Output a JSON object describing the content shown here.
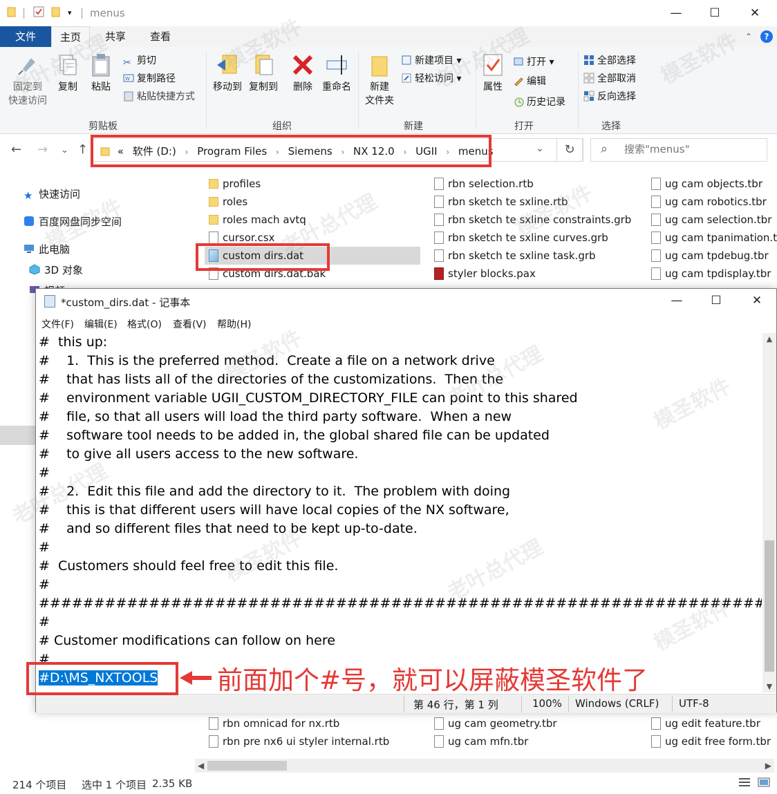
{
  "explorer": {
    "title": "menus",
    "ribbon_tabs": {
      "file": "文件",
      "home": "主页",
      "share": "共享",
      "view": "查看"
    },
    "groups": {
      "clipboard": {
        "label": "剪贴板",
        "pin": "固定到\n快速访问",
        "copy": "复制",
        "paste": "粘贴",
        "cut": "剪切",
        "copy_path": "复制路径",
        "paste_shortcut": "粘贴快捷方式"
      },
      "organize": {
        "label": "组织",
        "move_to": "移动到",
        "copy_to": "复制到",
        "delete": "删除",
        "rename": "重命名"
      },
      "new": {
        "label": "新建",
        "new_folder": "新建\n文件夹",
        "new_item": "新建项目",
        "easy_access": "轻松访问"
      },
      "open": {
        "label": "打开",
        "properties": "属性",
        "open": "打开",
        "edit": "编辑",
        "history": "历史记录"
      },
      "select": {
        "label": "选择",
        "select_all": "全部选择",
        "select_none": "全部取消",
        "invert": "反向选择"
      }
    },
    "address": {
      "prefix": "«",
      "crumbs": [
        "软件 (D:)",
        "Program Files",
        "Siemens",
        "NX 12.0",
        "UGII",
        "menus"
      ]
    },
    "search": {
      "placeholder": "搜索\"menus\""
    },
    "nav": {
      "quick_access": "快速访问",
      "baidu": "百度网盘同步空间",
      "this_pc": "此电脑",
      "objects_3d": "3D 对象",
      "video_partial": "视频"
    },
    "files_col1": [
      "profiles",
      "roles",
      "roles mach avtq",
      "cursor.csx",
      "custom dirs.dat",
      "custom dirs.dat.bak"
    ],
    "files_col2": [
      "rbn selection.rtb",
      "rbn sketch te sxline.rtb",
      "rbn sketch te sxline constraints.grb",
      "rbn sketch te sxline curves.grb",
      "rbn sketch te sxline task.grb",
      "styler blocks.pax"
    ],
    "files_col3": [
      "ug cam objects.tbr",
      "ug cam robotics.tbr",
      "ug cam selection.tbr",
      "ug cam tpanimation.t",
      "ug cam tpdebug.tbr",
      "ug cam tpdisplay.tbr"
    ],
    "bottom_files": {
      "col1": [
        "rbn omnicad for nx.rtb",
        "rbn pre nx6 ui styler internal.rtb"
      ],
      "col2": [
        "ug cam geometry.tbr",
        "ug cam mfn.tbr"
      ],
      "col3": [
        "ug edit feature.tbr",
        "ug edit free form.tbr"
      ]
    },
    "status": {
      "count": "214 个项目",
      "selected": "选中 1 个项目",
      "size": "2.35 KB"
    }
  },
  "notepad": {
    "title": "*custom_dirs.dat - 记事本",
    "menu": [
      "文件(F)",
      "编辑(E)",
      "格式(O)",
      "查看(V)",
      "帮助(H)"
    ],
    "lines": [
      "#  this up:",
      "#    1.  This is the preferred method.  Create a file on a network drive",
      "#    that has lists all of the directories of the customizations.  Then the",
      "#    environment variable UGII_CUSTOM_DIRECTORY_FILE can point to this shared",
      "#    file, so that all users will load the third party software.  When a new",
      "#    software tool needs to be added in, the global shared file can be updated",
      "#    to give all users access to the new software.",
      "#",
      "#    2.  Edit this file and add the directory to it.  The problem with doing",
      "#    this is that different users will have local copies of the NX software,",
      "#    and so different files that need to be kept up-to-date.",
      "#",
      "#  Customers should feel free to edit this file.",
      "#",
      "###########################################################################",
      "#",
      "# Customer modifications can follow on here",
      "#"
    ],
    "highlighted_line": "#D:\\MS_NXTOOLS",
    "status": {
      "position": "第 46 行，第 1 列",
      "zoom": "100%",
      "eol": "Windows (CRLF)",
      "encoding": "UTF-8"
    }
  },
  "annotation": {
    "text": "前面加个#号，就可以屏蔽模圣软件了",
    "color": "#e53935"
  },
  "watermark": {
    "text_a": "模圣软件",
    "text_b": "老叶总代理"
  }
}
